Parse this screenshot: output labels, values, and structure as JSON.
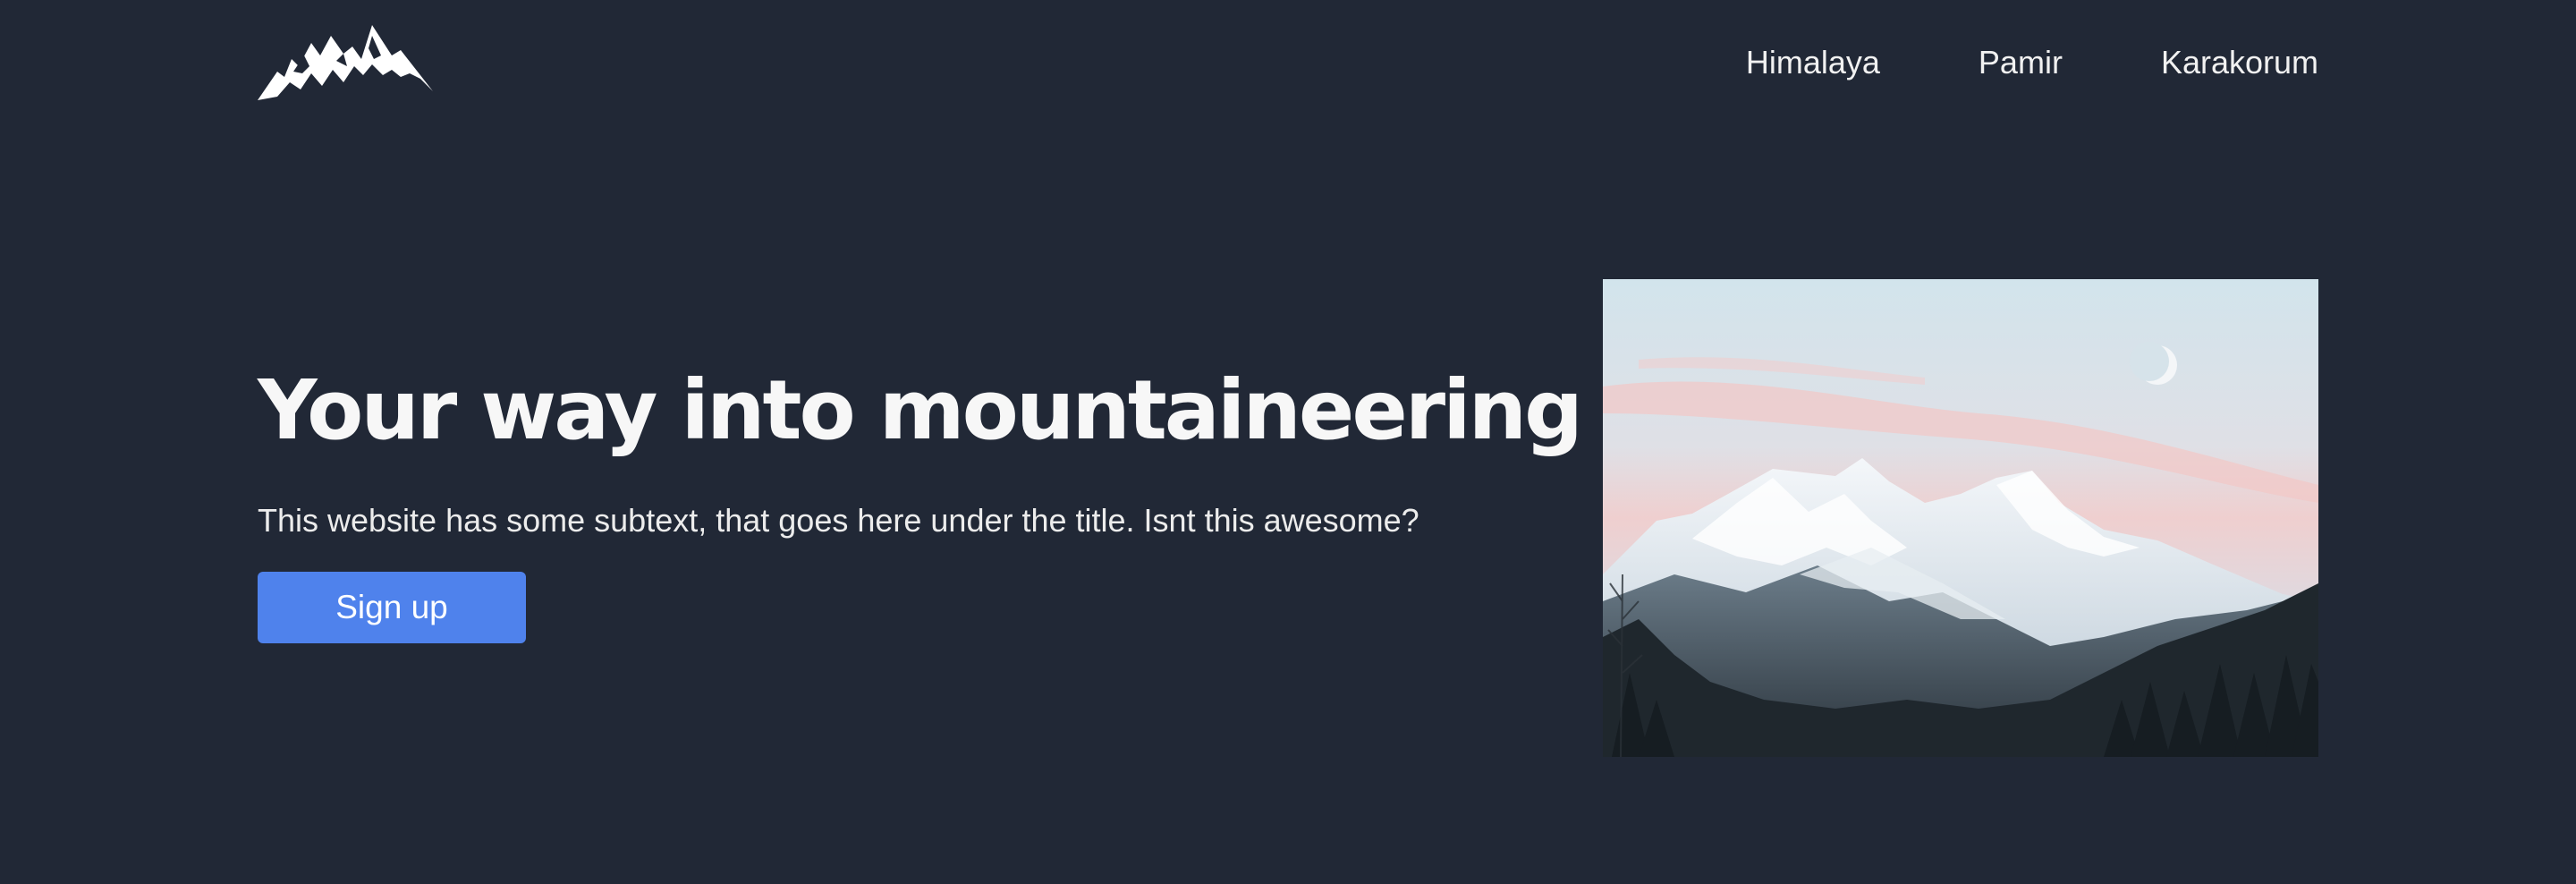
{
  "header": {
    "logo_icon": "mountain-logo-icon",
    "nav": [
      {
        "label": "Himalaya"
      },
      {
        "label": "Pamir"
      },
      {
        "label": "Karakorum"
      }
    ]
  },
  "hero": {
    "title": "Your way into mountaineering",
    "subtitle": "This website has some subtext, that goes here under the title. Isnt this awesome?",
    "cta_label": "Sign up"
  },
  "photo": {
    "icon": "mountain-photo"
  },
  "colors": {
    "background": "#212836",
    "accent": "#4f82ec",
    "text": "#f5f5f5"
  }
}
